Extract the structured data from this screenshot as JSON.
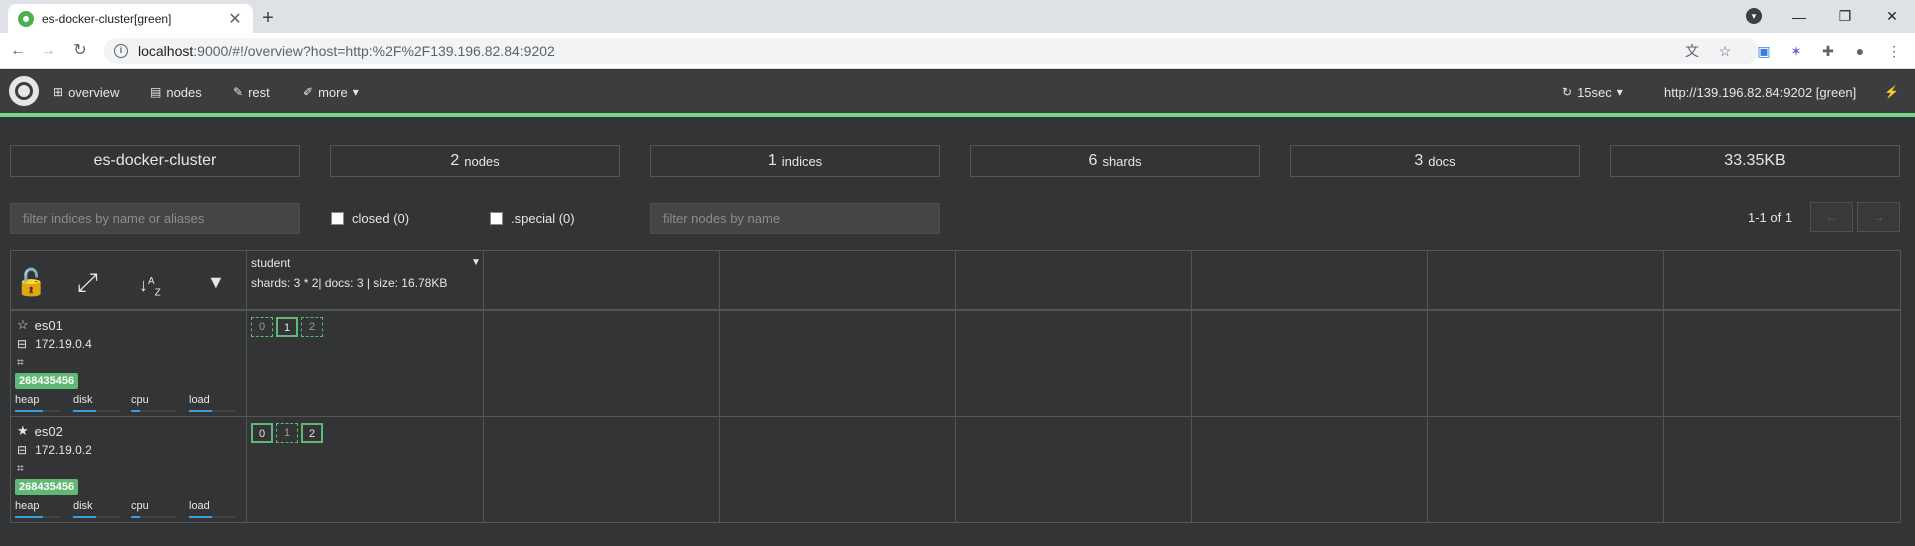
{
  "browser": {
    "tab_title": "es-docker-cluster[green]",
    "tab_close": "✕",
    "new_tab": "+",
    "url_host": "localhost",
    "url_path": ":9000/#!/overview?host=http:%2F%2F139.196.82.84:9202"
  },
  "appnav": {
    "items": [
      {
        "icon": "sitemap",
        "label": "overview"
      },
      {
        "icon": "server",
        "label": "nodes"
      },
      {
        "icon": "edit",
        "label": "rest"
      },
      {
        "icon": "wrench",
        "label": "more"
      }
    ],
    "refresh": "15sec",
    "host": "http://139.196.82.84:9202 [green]"
  },
  "stats": {
    "cluster_name": "es-docker-cluster",
    "nodes_count": "2",
    "nodes_label": "nodes",
    "indices_count": "1",
    "indices_label": "indices",
    "shards_count": "6",
    "shards_label": "shards",
    "docs_count": "3",
    "docs_label": "docs",
    "size": "33.35KB"
  },
  "filters": {
    "indices_placeholder": "filter indices by name or aliases",
    "closed_label": "closed (0)",
    "special_label": ".special (0)",
    "nodes_placeholder": "filter nodes by name",
    "pager_text": "1-1 of 1",
    "prev": "←",
    "next": "→"
  },
  "index": {
    "name": "student",
    "info": "shards: 3 * 2| docs: 3 | size: 16.78KB"
  },
  "nodes": [
    {
      "name": "es01",
      "master": false,
      "ip": "172.19.0.4",
      "badge": "268435456",
      "metrics": [
        "heap",
        "disk",
        "cpu",
        "load"
      ],
      "metric_fill": [
        0.6,
        0.5,
        0.2,
        0.5
      ],
      "shards": [
        {
          "label": "0",
          "primary": false
        },
        {
          "label": "1",
          "primary": true
        },
        {
          "label": "2",
          "primary": false
        }
      ]
    },
    {
      "name": "es02",
      "master": true,
      "ip": "172.19.0.2",
      "badge": "268435456",
      "metrics": [
        "heap",
        "disk",
        "cpu",
        "load"
      ],
      "metric_fill": [
        0.6,
        0.5,
        0.2,
        0.5
      ],
      "shards": [
        {
          "label": "0",
          "primary": true
        },
        {
          "label": "1",
          "primary": false
        },
        {
          "label": "2",
          "primary": true
        }
      ]
    }
  ],
  "colors": {
    "status_green": "#61b875",
    "accent_line": "#7bd48c",
    "metric_blue": "#3a9ee6"
  }
}
